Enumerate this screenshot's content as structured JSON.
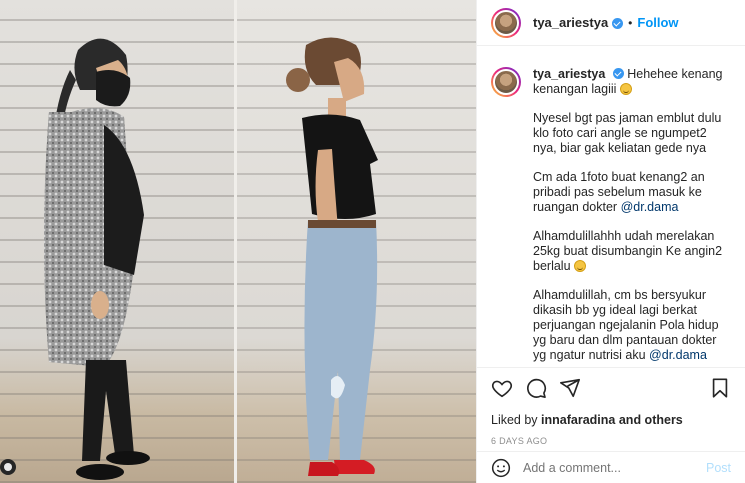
{
  "header": {
    "username": "tya_ariestya",
    "dot": "•",
    "follow_label": "Follow"
  },
  "caption": {
    "username": "tya_ariestya",
    "first_line": "Hehehee kenang kenangan lagiii",
    "paragraphs": [
      "Nyesel bgt pas jaman emblut dulu klo foto cari angle se ngumpet2 nya, biar gak keliatan gede nya",
      "Cm ada 1foto buat kenang2 an pribadi pas sebelum masuk ke ruangan dokter",
      "Alhamdulillahhh udah merelakan 25kg buat disumbangin Ke angin2 berlalu",
      "Alhamdulillah, cm bs bersyukur dikasih bb yg ideal lagi berkat perjuangan ngejalanin Pola hidup yg baru dan dlm pantauan dokter yg ngatur nutrisi aku"
    ],
    "mention_1": "@dr.dama",
    "mention_2": "@dr.dama"
  },
  "actions": {
    "like_icon": "heart-icon",
    "comment_icon": "comment-icon",
    "share_icon": "share-icon",
    "save_icon": "bookmark-icon"
  },
  "likes": {
    "prefix": "Liked by",
    "user": "innafaradina",
    "suffix": "and others"
  },
  "timestamp": "6 DAYS AGO",
  "comment_box": {
    "placeholder": "Add a comment...",
    "post_label": "Post"
  },
  "colors": {
    "accent": "#0095f6",
    "verified": "#3897f0",
    "mention": "#00376b",
    "post_disabled": "#b2dffc"
  }
}
